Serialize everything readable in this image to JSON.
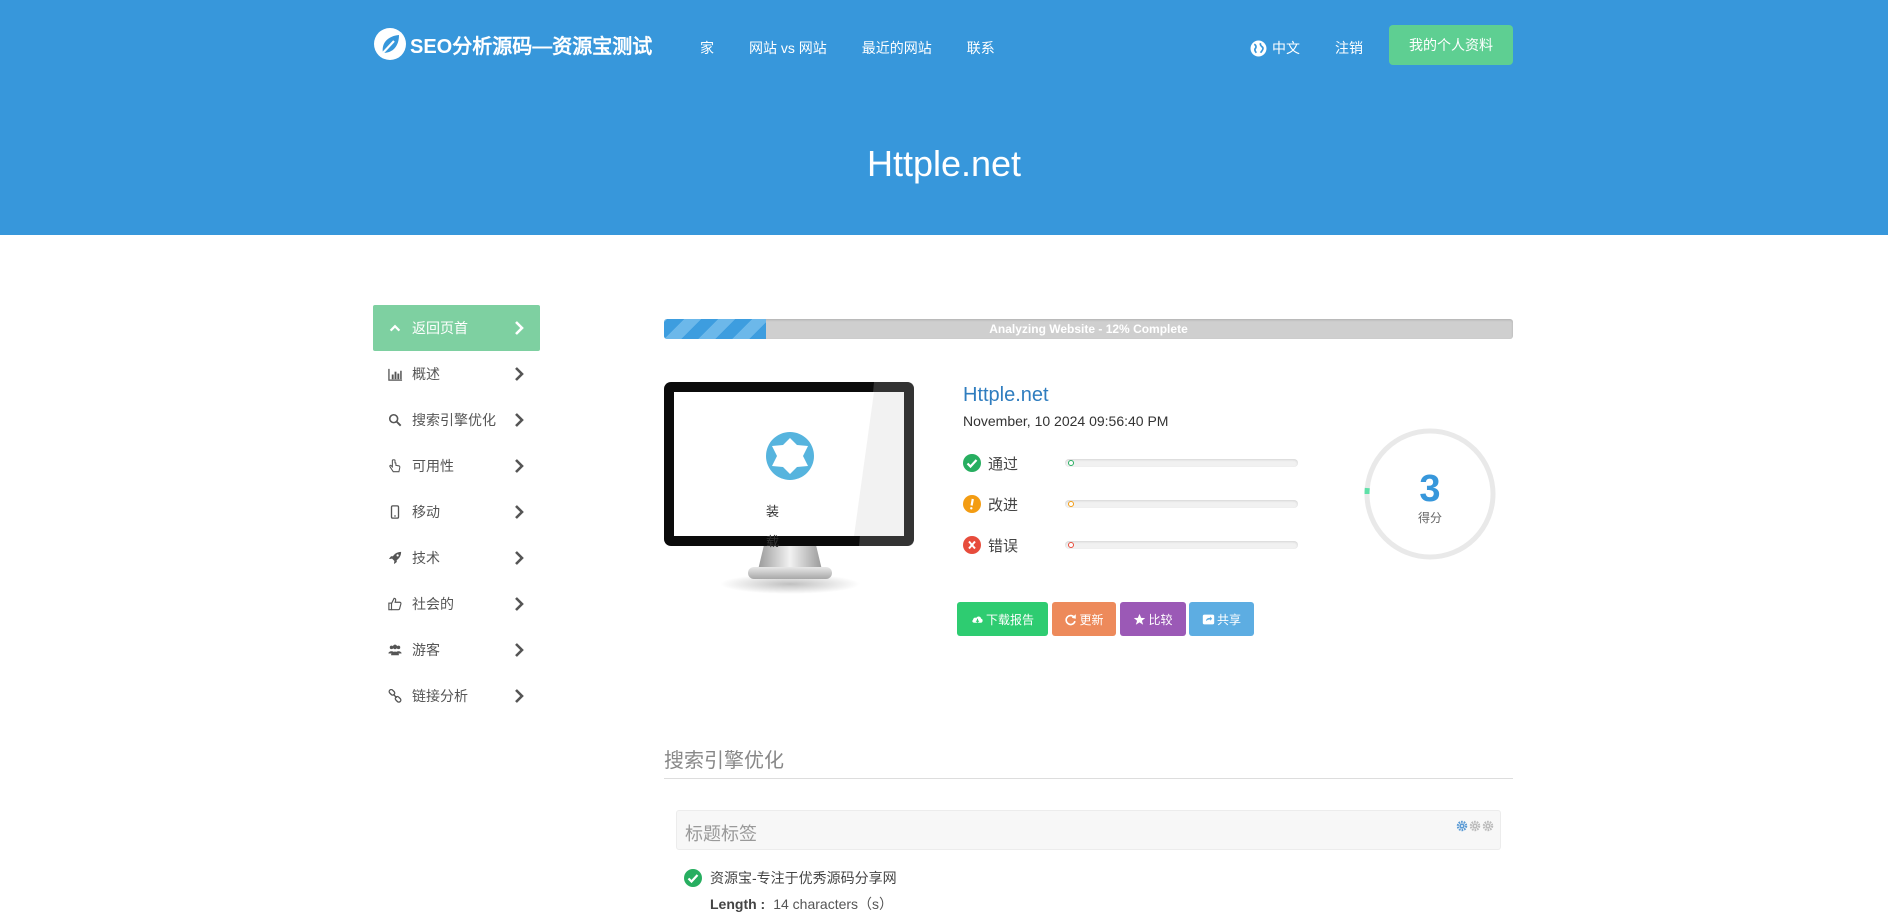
{
  "header": {
    "logo_text": "SEO分析源码—资源宝测试",
    "nav": [
      "家",
      "网站 vs 网站",
      "最近的网站",
      "联系"
    ],
    "language": "中文",
    "logout": "注销",
    "profile_button": "我的个人资料",
    "site_title": "Httple.net"
  },
  "sidebar": {
    "items": [
      {
        "label": "返回页首",
        "icon": "chevron-up-icon"
      },
      {
        "label": "概述",
        "icon": "bar-chart-icon"
      },
      {
        "label": "搜索引擎优化",
        "icon": "search-icon"
      },
      {
        "label": "可用性",
        "icon": "hand-pointer-icon"
      },
      {
        "label": "移动",
        "icon": "mobile-icon"
      },
      {
        "label": "技术",
        "icon": "rocket-icon"
      },
      {
        "label": "社会的",
        "icon": "thumbs-up-icon"
      },
      {
        "label": "游客",
        "icon": "users-icon"
      },
      {
        "label": "链接分析",
        "icon": "link-icon"
      }
    ]
  },
  "progress": {
    "text": "Analyzing Website - 12% Complete",
    "percent": 12
  },
  "preview": {
    "loading_text_1": "装",
    "loading_text_2": "载"
  },
  "summary": {
    "title": "Httple.net",
    "date": "November, 10 2024 09:56:40 PM",
    "stats": [
      {
        "label": "通过",
        "color": "#27ae60",
        "icon": "check-circle-icon"
      },
      {
        "label": "改进",
        "color": "#f39c12",
        "icon": "exclamation-circle-icon"
      },
      {
        "label": "错误",
        "color": "#e74c3c",
        "icon": "x-circle-icon"
      }
    ],
    "score": "3",
    "score_label": "得分",
    "score_percent": 3
  },
  "actions": [
    {
      "label": "下载报告",
      "color": "#2ecc71",
      "icon": "cloud-download-icon"
    },
    {
      "label": "更新",
      "color": "#ed8a5b",
      "icon": "refresh-icon"
    },
    {
      "label": "比较",
      "color": "#9b59b6",
      "icon": "star-icon"
    },
    {
      "label": "共享",
      "color": "#5dade2",
      "icon": "share-icon"
    }
  ],
  "seo_section": {
    "title": "搜索引擎优化",
    "card_title": "标题标签",
    "result_text": "资源宝-专注于优秀源码分享网",
    "length_label": "Length :",
    "length_value": "14 characters（s）"
  },
  "colors": {
    "header_bg": "#3797db",
    "accent_green": "#5ecf92",
    "sidebar_active": "#7ed0a1"
  }
}
